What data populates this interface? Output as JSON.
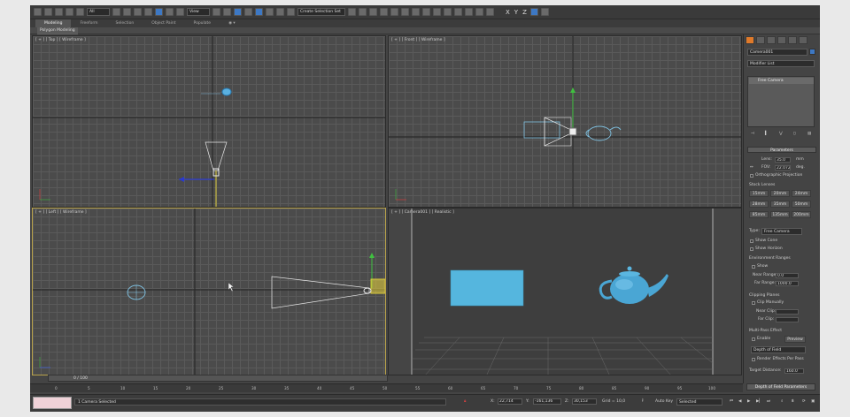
{
  "toolbar": {
    "selection_filter": "All",
    "ref_coord": "View",
    "named_selection": "Create Selection Set",
    "axes": [
      "X",
      "Y",
      "Z"
    ]
  },
  "ribbon": {
    "tabs": [
      "Modeling",
      "Freeform",
      "Selection",
      "Object Paint",
      "Populate"
    ],
    "active_tab": "Modeling",
    "panel": "Polygon Modeling"
  },
  "viewports": {
    "top": "[ + ] [ Top ] [ Wireframe ]",
    "front": "[ + ] [ Front ] [ Wireframe ]",
    "left": "[ + ] [ Left ] [ Wireframe ]",
    "camera": "[ + ] [ Camera001 ] [ Realistic ]"
  },
  "command_panel": {
    "object_name": "Camera001",
    "object_color": "#3d78c4",
    "modifier_list": "Modifier List",
    "stack_item": "Free Camera",
    "parameters_title": "Parameters",
    "lens_label": "Lens:",
    "lens_value": "35.0",
    "lens_unit": "mm",
    "fov_label": "FOV:",
    "fov_value": "22.072",
    "fov_unit": "deg.",
    "ortho_label": "Orthographic Projection",
    "stock_lenses_label": "Stock Lenses",
    "stock_lenses": [
      "15mm",
      "20mm",
      "24mm",
      "28mm",
      "35mm",
      "50mm",
      "85mm",
      "135mm",
      "200mm"
    ],
    "type_label": "Type:",
    "type_value": "Free Camera",
    "show_cone": "Show Cone",
    "show_horizon": "Show Horizon",
    "env_ranges": "Environment Ranges",
    "env_show": "Show",
    "near_range_label": "Near Range:",
    "near_range_value": "0.0",
    "far_range_label": "Far Range:",
    "far_range_value": "1000.0",
    "clipping_planes": "Clipping Planes",
    "clip_manually": "Clip Manually",
    "near_clip_label": "Near Clip:",
    "far_clip_label": "Far Clip:",
    "multipass": "Multi-Pass Effect",
    "enable_label": "Enable",
    "preview_label": "Preview",
    "effect_value": "Depth of Field",
    "render_effects": "Render Effects Per Pass",
    "target_distance_label": "Target Distance:",
    "target_distance_value": "160.0",
    "dof_params": "Depth of Field Parameters"
  },
  "timeline": {
    "frame_counter": "0 / 100",
    "ticks": [
      "0",
      "5",
      "10",
      "15",
      "20",
      "25",
      "30",
      "35",
      "40",
      "45",
      "50",
      "55",
      "60",
      "65",
      "70",
      "75",
      "80",
      "85",
      "90",
      "95",
      "100"
    ]
  },
  "status": {
    "message": "1 Camera Selected",
    "x_label": "X:",
    "x_value": "22,714",
    "y_label": "Y:",
    "y_value": "-161,136",
    "z_label": "Z:",
    "z_value": "30,153",
    "grid": "Grid = 10,0",
    "autokey": "Auto Key",
    "selected": "Selected"
  }
}
